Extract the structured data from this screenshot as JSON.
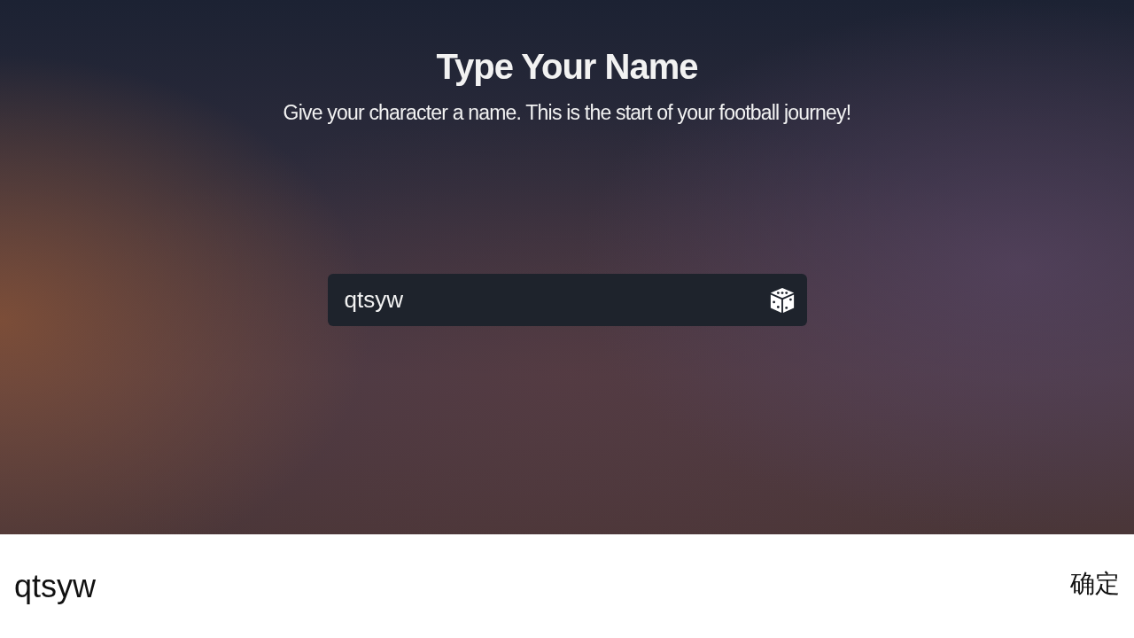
{
  "title": "Type Your Name",
  "subtitle": "Give your character a name. This is the start of your football journey!",
  "name_field": {
    "value": "qtsyw"
  },
  "keyboard_bar": {
    "text": "qtsyw",
    "confirm": "确定"
  }
}
